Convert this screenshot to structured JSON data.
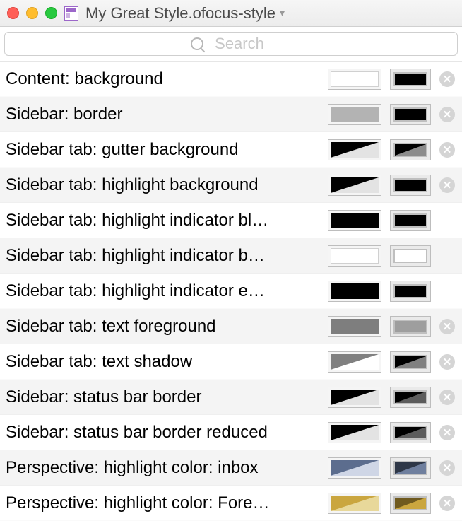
{
  "window": {
    "title": "My Great Style.ofocus-style"
  },
  "search": {
    "placeholder": "Search",
    "value": ""
  },
  "rows": [
    {
      "label": "Content: background",
      "l_type": "solid",
      "l_c1": "#ffffff",
      "r_type": "solid",
      "r_c1": "#000000",
      "clear": true
    },
    {
      "label": "Sidebar: border",
      "l_type": "solid",
      "l_c1": "#b3b3b3",
      "r_type": "solid",
      "r_c1": "#000000",
      "clear": true
    },
    {
      "label": "Sidebar tab: gutter background",
      "l_type": "diag",
      "l_c1": "#000000",
      "l_c2": "#e3e3e3",
      "r_type": "diag",
      "r_c1": "#000000",
      "r_c2": "#8c8c8c",
      "clear": true
    },
    {
      "label": "Sidebar tab: highlight background",
      "l_type": "diag",
      "l_c1": "#000000",
      "l_c2": "#e3e3e3",
      "r_type": "solid",
      "r_c1": "#000000",
      "clear": true
    },
    {
      "label": "Sidebar tab: highlight indicator bl…",
      "l_type": "solid",
      "l_c1": "#000000",
      "r_type": "solid",
      "r_c1": "#000000",
      "clear": false
    },
    {
      "label": "Sidebar tab: highlight indicator b…",
      "l_type": "solid",
      "l_c1": "#ffffff",
      "r_type": "outline",
      "r_c1": "#bfbfbf",
      "clear": false
    },
    {
      "label": "Sidebar tab: highlight indicator e…",
      "l_type": "solid",
      "l_c1": "#000000",
      "r_type": "solid",
      "r_c1": "#000000",
      "clear": false
    },
    {
      "label": "Sidebar tab: text foreground",
      "l_type": "solid",
      "l_c1": "#7e7e7e",
      "r_type": "solid",
      "r_c1": "#9e9e9e",
      "clear": true
    },
    {
      "label": "Sidebar tab: text shadow",
      "l_type": "diag",
      "l_c1": "#808080",
      "l_c2": "#ffffff",
      "r_type": "diag",
      "r_c1": "#000000",
      "r_c2": "#808080",
      "clear": true
    },
    {
      "label": "Sidebar: status bar border",
      "l_type": "diag",
      "l_c1": "#000000",
      "l_c2": "#e3e3e3",
      "r_type": "diag",
      "r_c1": "#000000",
      "r_c2": "#5c5c5c",
      "clear": true
    },
    {
      "label": "Sidebar: status bar border reduced",
      "l_type": "diag",
      "l_c1": "#000000",
      "l_c2": "#e3e3e3",
      "r_type": "diag",
      "r_c1": "#000000",
      "r_c2": "#5c5c5c",
      "clear": true
    },
    {
      "label": "Perspective: highlight color: inbox",
      "l_type": "diag",
      "l_c1": "#5c6d8e",
      "l_c2": "#cfd6e6",
      "r_type": "diag",
      "r_c1": "#2e3747",
      "r_c2": "#6f7f9e",
      "clear": true
    },
    {
      "label": "Perspective: highlight color: Fore…",
      "l_type": "diag",
      "l_c1": "#caa63f",
      "l_c2": "#e8d89a",
      "r_type": "diag",
      "r_c1": "#6f5a1f",
      "r_c2": "#caa63f",
      "clear": true
    }
  ]
}
